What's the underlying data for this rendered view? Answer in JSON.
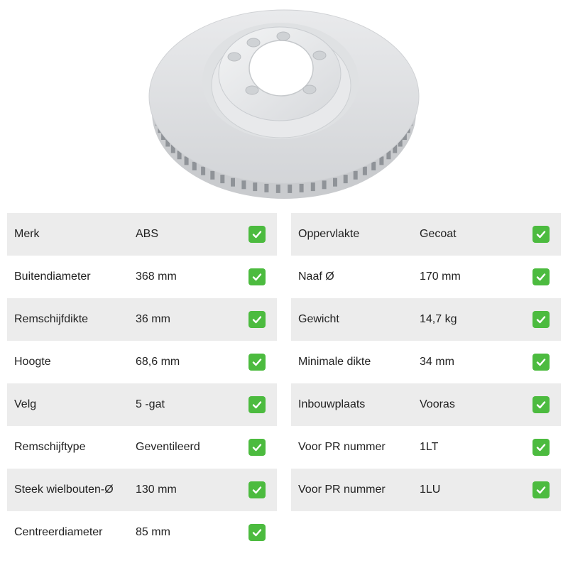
{
  "product": {
    "image_icon": "brake-disc-image",
    "check_icon": "check-mark-icon",
    "check_color": "#4cbb3f"
  },
  "specs_left": [
    {
      "label": "Merk",
      "value": "ABS"
    },
    {
      "label": "Buitendiameter",
      "value": "368 mm"
    },
    {
      "label": "Remschijfdikte",
      "value": "36 mm"
    },
    {
      "label": "Hoogte",
      "value": "68,6 mm"
    },
    {
      "label": "Velg",
      "value": "5 -gat"
    },
    {
      "label": "Remschijftype",
      "value": "Geventileerd"
    },
    {
      "label": "Steek wielbouten-Ø",
      "value": "130 mm"
    },
    {
      "label": "Centreerdiameter",
      "value": "85 mm"
    }
  ],
  "specs_right": [
    {
      "label": "Oppervlakte",
      "value": "Gecoat"
    },
    {
      "label": "Naaf Ø",
      "value": "170 mm"
    },
    {
      "label": "Gewicht",
      "value": "14,7 kg"
    },
    {
      "label": "Minimale dikte",
      "value": "34 mm"
    },
    {
      "label": "Inbouwplaats",
      "value": "Vooras"
    },
    {
      "label": "Voor PR nummer",
      "value": "1LT"
    },
    {
      "label": "Voor PR nummer",
      "value": "1LU"
    }
  ]
}
